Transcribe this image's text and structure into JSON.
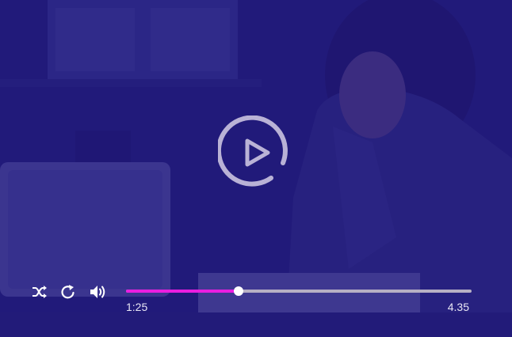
{
  "player": {
    "current_time": "1:25",
    "total_time": "4.35",
    "progress": 0.325,
    "colors": {
      "overlay": "#1c147d",
      "progress_fill": "#e91ee0",
      "progress_track": "#b7b0c4",
      "thumb": "#ffffff",
      "icons": "#ffffff",
      "play_ring": "#b9b2d6"
    },
    "icons": {
      "play": "play-circle-icon",
      "shuffle": "shuffle-icon",
      "replay": "replay-icon",
      "volume": "volume-icon"
    }
  }
}
